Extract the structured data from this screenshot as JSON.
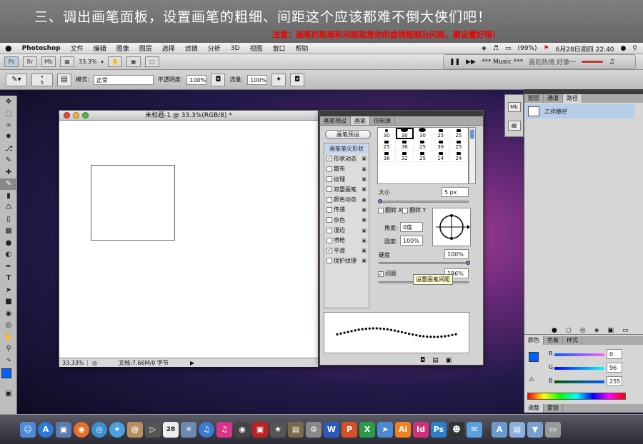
{
  "banner": {
    "title": "三、调出画笔面板，设置画笔的粗细、间距这个应该都难不倒大侠们吧！",
    "note": "注意：画笔的粗细和间距就是你的虚线粗细及间距，要设置好哦！"
  },
  "menubar": {
    "apple": "",
    "app_name": "Photoshop",
    "items": [
      "文件",
      "编辑",
      "图像",
      "图层",
      "选择",
      "滤镜",
      "分析",
      "3D",
      "视图",
      "窗口",
      "帮助"
    ],
    "battery": "(99%)",
    "datetime": "6月28日周四  22:40"
  },
  "appbar": {
    "ps": "Ps",
    "br": "Br",
    "mb": "Mb",
    "zoom": "33.3%"
  },
  "music": {
    "title": "*** Music ***",
    "song": "我的热情  好像一"
  },
  "options": {
    "brush_size": "5",
    "mode_label": "模式:",
    "mode_value": "正常",
    "opacity_label": "不透明度:",
    "opacity_value": "100%",
    "flow_label": "流量:",
    "flow_value": "100%"
  },
  "document": {
    "title": "未标题-1 @ 33.3%(RGB/8) *",
    "zoom": "33.33%",
    "doc_info": "文档:7.66M/0 字节"
  },
  "brush_panel": {
    "tabs": [
      "画笔预设",
      "画笔",
      "仿制源"
    ],
    "active_tab": "画笔",
    "preset_button": "画笔预设",
    "list_header": "画笔笔尖形状",
    "list_items": [
      {
        "label": "形状动态",
        "checked": true
      },
      {
        "label": "散布",
        "checked": false
      },
      {
        "label": "纹理",
        "checked": false
      },
      {
        "label": "双重画笔",
        "checked": false
      },
      {
        "label": "颜色动态",
        "checked": false
      },
      {
        "label": "传递",
        "checked": false
      },
      {
        "label": "杂色",
        "checked": false
      },
      {
        "label": "湿边",
        "checked": false
      },
      {
        "label": "喷枪",
        "checked": false
      },
      {
        "label": "平滑",
        "checked": true
      },
      {
        "label": "保护纹理",
        "checked": false
      }
    ],
    "tip_sizes": [
      "30",
      "30",
      "30",
      "25",
      "25",
      "25",
      "36",
      "25",
      "36",
      "25",
      "36",
      "32",
      "25",
      "14",
      "24"
    ],
    "size_label": "大小",
    "size_value": "5 px",
    "flip_x": "翻转 X",
    "flip_y": "翻转 Y",
    "angle_label": "角度:",
    "angle_value": "0度",
    "roundness_label": "圆度:",
    "roundness_value": "100%",
    "hardness_label": "硬度",
    "hardness_value": "100%",
    "spacing_label": "间距",
    "spacing_value": "196%",
    "tooltip": "设置画笔间距"
  },
  "layers_panel": {
    "tabs": [
      "图层",
      "通道",
      "路径"
    ],
    "active_tab": "路径",
    "path_item": "工作路径"
  },
  "color_panel": {
    "tabs": [
      "颜色",
      "色板",
      "样式"
    ],
    "r_label": "R",
    "r_value": "0",
    "g_label": "G",
    "g_value": "96",
    "b_label": "B",
    "b_value": "255",
    "bottom_tabs": [
      "调整",
      "蒙版"
    ],
    "foreground_color": "#0060ff"
  },
  "dock": {
    "ai": "Ai",
    "id": "Id",
    "ps": "Ps",
    "calendar_day": "28"
  }
}
